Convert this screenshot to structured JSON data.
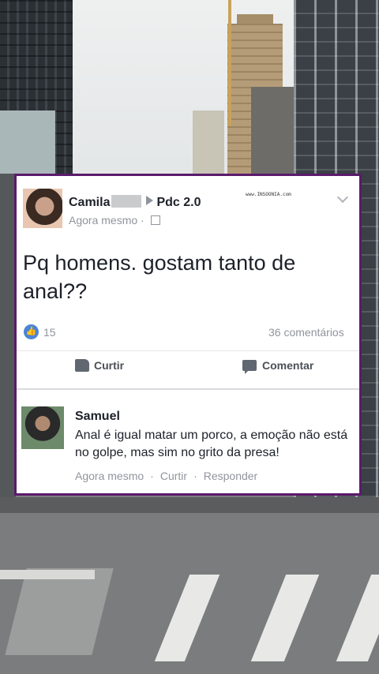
{
  "post": {
    "author_first": "Camila",
    "group": "Pdc 2.0",
    "time": "Agora mesmo",
    "watermark": "www.INSOONIA.com",
    "text": "Pq homens. gostam tanto de anal??",
    "likes": "15",
    "comments": "36 comentários",
    "like_label": "Curtir",
    "comment_label": "Comentar"
  },
  "comment": {
    "author": "Samuel",
    "text": "Anal é igual matar um porco, a emoção não está no golpe, mas sim no grito da presa!",
    "time": "Agora mesmo",
    "like_label": "Curtir",
    "reply_label": "Responder"
  },
  "colors": {
    "frame": "#5a1a6a",
    "like_blue": "#4a85d6"
  }
}
